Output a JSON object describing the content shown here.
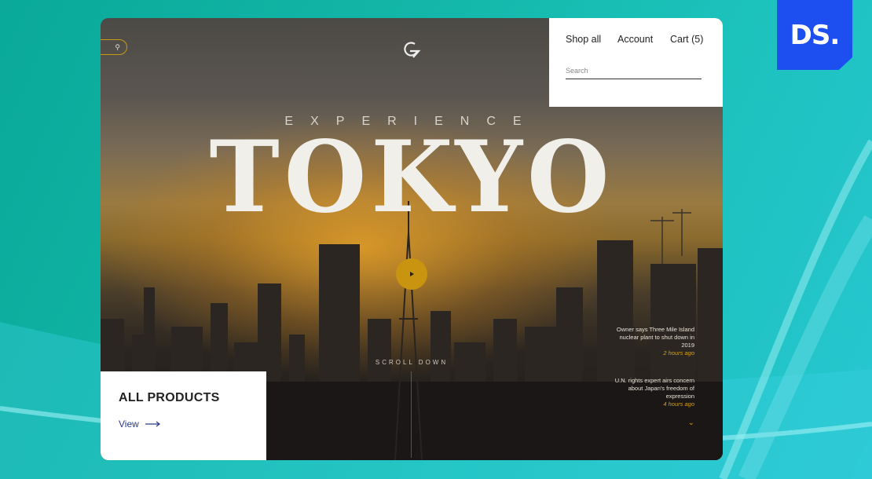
{
  "brand_badge": {
    "text": "DS."
  },
  "hero": {
    "kicker": "EXPERIENCE",
    "title": "TOKYO",
    "scroll_label": "SCROLL DOWN"
  },
  "nav": {
    "shop_all": "Shop all",
    "account": "Account",
    "cart": "Cart (5)",
    "search_placeholder": "Search"
  },
  "news": [
    {
      "headline": "Owner says Three Mile Island nuclear plant to shut down in 2019",
      "time": "2 hours ago"
    },
    {
      "headline": "U.N. rights expert airs concern about Japan's freedom of expression",
      "time": "4 hours ago"
    }
  ],
  "products": {
    "title": "ALL PRODUCTS",
    "link": "View"
  },
  "icons": [
    "search-icon",
    "logo-icon",
    "play-icon",
    "arrow-right-icon",
    "chevron-down-icon"
  ],
  "colors": {
    "accent": "#c9940f",
    "badge": "#1d4ff0",
    "background": "#12b5a6"
  }
}
